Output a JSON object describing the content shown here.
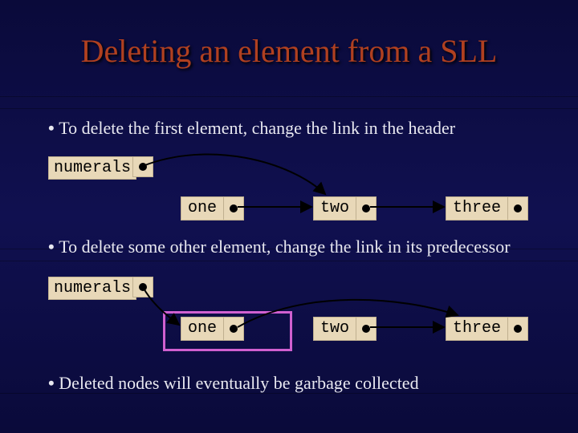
{
  "title": "Deleting an element from a SLL",
  "bullets": {
    "b1": "To delete the first element, change the link in the header",
    "b2": "To delete some other element, change the link in its predecessor",
    "b3": "Deleted nodes will eventually be garbage collected"
  },
  "labels": {
    "numerals": "numerals"
  },
  "nodes": {
    "n1": "one",
    "n2": "two",
    "n3": "three"
  },
  "arrows": {
    "diagram1": [
      {
        "from": [
          178,
          207
        ],
        "curve": [
          260,
          175,
          360,
          200,
          405,
          242
        ],
        "desc": "header to two (skip one)"
      },
      {
        "from": [
          296,
          258
        ],
        "curve": [
          340,
          258,
          370,
          258,
          388,
          258
        ],
        "desc": "one to two"
      },
      {
        "from": [
          461,
          258
        ],
        "curve": [
          500,
          258,
          530,
          258,
          553,
          258
        ],
        "desc": "two to three"
      }
    ],
    "diagram2": [
      {
        "from": [
          178,
          358
        ],
        "curve": [
          190,
          380,
          210,
          395,
          223,
          405
        ],
        "desc": "header to one"
      },
      {
        "from": [
          296,
          408
        ],
        "curve": [
          380,
          360,
          500,
          370,
          570,
          393
        ],
        "desc": "one to three (skip two)"
      },
      {
        "from": [
          461,
          408
        ],
        "curve": [
          500,
          408,
          530,
          408,
          553,
          408
        ],
        "desc": "two to three"
      }
    ]
  }
}
